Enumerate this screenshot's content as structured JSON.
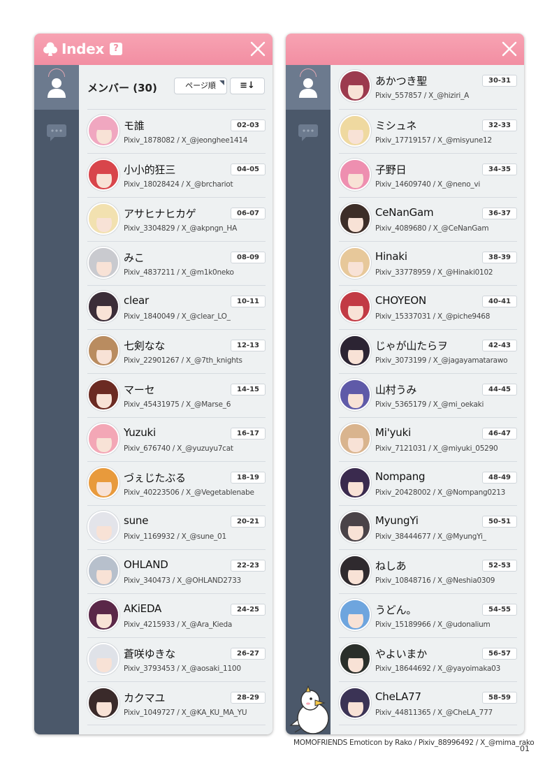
{
  "index_panel": {
    "title": "Index",
    "help_label": "?",
    "members_header": "メンバー (30)",
    "sort_label": "ページ順",
    "order_label": "≡↓",
    "icons": {
      "app": "club-icon",
      "help": "question-icon",
      "close": "close-icon",
      "user": "user-icon",
      "chat": "chat-icon"
    }
  },
  "colors": {
    "titlebar": "#f28ea2",
    "sidebar": "#4b586a",
    "sidebar_active": "#6c7a8e",
    "list_bg": "#eef1f2"
  },
  "members_left": [
    {
      "name": "モ誰",
      "sub": "Pixiv_1878082 / X_@jeonghee1414",
      "pages": "02-03",
      "hair": "#f0a7c0"
    },
    {
      "name": "小小的狂三",
      "sub": "Pixiv_18028424 / X_@brchariot",
      "pages": "04-05",
      "hair": "#d8454b"
    },
    {
      "name": "アサヒナヒカゲ",
      "sub": "Pixiv_3304829 / X_@akpngn_HA",
      "pages": "06-07",
      "hair": "#f2e1b0"
    },
    {
      "name": "みこ",
      "sub": "Pixiv_4837211 / X_@m1k0neko",
      "pages": "08-09",
      "hair": "#c9cacf"
    },
    {
      "name": "clear",
      "sub": "Pixiv_1840049 / X_@clear_LO_",
      "pages": "10-11",
      "hair": "#3b2d38"
    },
    {
      "name": "七剣なな",
      "sub": "Pixiv_22901267 / X_@7th_knights",
      "pages": "12-13",
      "hair": "#b98c60"
    },
    {
      "name": "マーセ",
      "sub": "Pixiv_45431975 / X_@Marse_6",
      "pages": "14-15",
      "hair": "#6b2a22"
    },
    {
      "name": "Yuzuki",
      "sub": "Pixiv_676740 / X_@yuzuyu7cat",
      "pages": "16-17",
      "hair": "#f3a7b6"
    },
    {
      "name": "づぇじたぶる",
      "sub": "Pixiv_40223506 / X_@Vegetablenabe",
      "pages": "18-19",
      "hair": "#e89a3c"
    },
    {
      "name": "sune",
      "sub": "Pixiv_1169932 / X_@sune_01",
      "pages": "20-21",
      "hair": "#e3e4ea"
    },
    {
      "name": "OHLAND",
      "sub": "Pixiv_340473 / X_@OHLAND2733",
      "pages": "22-23",
      "hair": "#b7c0cc"
    },
    {
      "name": "AKiEDA",
      "sub": "Pixiv_4215933 / X_@Ara_Kieda",
      "pages": "24-25",
      "hair": "#5a2748"
    },
    {
      "name": "蒼咲ゆきな",
      "sub": "Pixiv_3793453 / X_@aosaki_1100",
      "pages": "26-27",
      "hair": "#dfe2e8"
    },
    {
      "name": "カクマユ",
      "sub": "Pixiv_1049727 / X_@KA_KU_MA_YU",
      "pages": "28-29",
      "hair": "#3a2a2a"
    }
  ],
  "members_right": [
    {
      "name": "あかつき聖",
      "sub": "Pixiv_557857 / X_@hiziri_A",
      "pages": "30-31",
      "hair": "#9c3a4e"
    },
    {
      "name": "ミシュネ",
      "sub": "Pixiv_17719157 / X_@misyune12",
      "pages": "32-33",
      "hair": "#efd9a0"
    },
    {
      "name": "子野日",
      "sub": "Pixiv_14609740 / X_@neno_vi",
      "pages": "34-35",
      "hair": "#ee8fb0"
    },
    {
      "name": "CeNanGam",
      "sub": "Pixiv_4089680 / X_@CeNanGam",
      "pages": "36-37",
      "hair": "#3d2e28"
    },
    {
      "name": "Hinaki",
      "sub": "Pixiv_33778959 / X_@Hinaki0102",
      "pages": "38-39",
      "hair": "#e7c89a"
    },
    {
      "name": "CHOYEON",
      "sub": "Pixiv_15337031 / X_@piche9468",
      "pages": "40-41",
      "hair": "#c23a44"
    },
    {
      "name": "じゃが山たらヲ",
      "sub": "Pixiv_3073199 / X_@jagayamatarawo",
      "pages": "42-43",
      "hair": "#2c2433"
    },
    {
      "name": "山村うみ",
      "sub": "Pixiv_5365179 / X_@mi_oekaki",
      "pages": "44-45",
      "hair": "#5f5aa8"
    },
    {
      "name": "Mi'yuki",
      "sub": "Pixiv_7121031 / X_@miyuki_05290",
      "pages": "46-47",
      "hair": "#d9b48e"
    },
    {
      "name": "Nompang",
      "sub": "Pixiv_20428002 / X_@Nompang0213",
      "pages": "48-49",
      "hair": "#3a2a4e"
    },
    {
      "name": "MyungYi",
      "sub": "Pixiv_38444677 / X_@MyungYi_",
      "pages": "50-51",
      "hair": "#4a4348"
    },
    {
      "name": "ねしあ",
      "sub": "Pixiv_10848716 / X_@Neshia0309",
      "pages": "52-53",
      "hair": "#2f2a2e"
    },
    {
      "name": "うどん。",
      "sub": "Pixiv_15189966 / X_@udonalium",
      "pages": "54-55",
      "hair": "#6ea5de"
    },
    {
      "name": "やよいまか",
      "sub": "Pixiv_18644692 / X_@yayoimaka03",
      "pages": "56-57",
      "hair": "#2a2f2a"
    },
    {
      "name": "CheLA77",
      "sub": "Pixiv_44811365 / X_@CheLA_777",
      "pages": "58-59",
      "hair": "#3b3355"
    }
  ],
  "credit": "MOMOFRIENDS Emoticon by Rako / Pixiv_88996492 / X_@mima_rako",
  "page_number": "01"
}
